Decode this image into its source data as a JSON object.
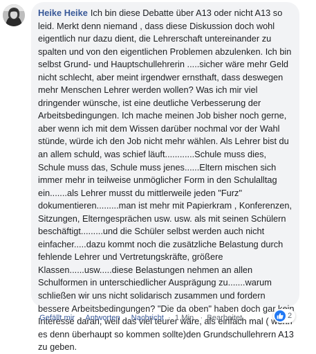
{
  "comment": {
    "author": "Heike Heike",
    "text": "Ich bin diese Debatte über A13 oder nicht A13 so leid. Merkt denn niemand , dass diese Diskussion doch wohl eigentlich nur dazu dient, die Lehrerschaft untereinander zu spalten und von den eigentlichen Problemen abzulenken. Ich bin selbst Grund- und Hauptschullehrerin .....sicher wäre mehr Geld nicht schlecht, aber meint irgendwer ernsthaft, dass deswegen mehr Menschen Lehrer werden wollen? Was ich mir viel dringender wünsche, ist eine deutliche Verbesserung der Arbeitsbedingungen. Ich mache meinen Job bisher noch gerne, aber wenn ich mit dem Wissen darüber nochmal vor der Wahl stünde, würde ich den Job nicht mehr wählen. Als Lehrer bist du an allem schuld, was schief läuft............Schule muss dies, Schule muss das, Schule muss jenes......Eltern mischen sich immer mehr in teilweise unmöglicher Form in den Schulalltag ein.......als Lehrer musst du mittlerweile jeden \"Furz\" dokumentieren.........man ist mehr mit Papierkram , Konferenzen, Sitzungen, Elterngesprächen usw. usw. als mit seinen Schülern beschäftigt.........und die Schüler selbst werden auch nicht einfacher.....dazu kommt noch die zusätzliche Belastung durch fehlende Lehrer und Vertretungskräfte, größere Klassen......usw.....diese Belastungen nehmen an allen Schulformen in unterschiedlicher Ausprägung zu.......warum schließen wir uns nicht solidarisch zusammen und fordern bessere Arbeitsbedingungen? \"Die da oben\" haben doch gar kein Interesse daran, weil das viel teurer wäre, als einfach mal ( wenn es denn überhaupt so kommen sollte)den Grundschullehrern A13 zu geben."
  },
  "reactions": {
    "icon": "thumbs-up-icon",
    "count": "2",
    "color": "#2078f4"
  },
  "actions": {
    "like": "Gefällt mir",
    "reply": "Antworten",
    "message": "Nachricht",
    "time": "1 Min.",
    "edited": "Bearbeitet",
    "separator": "·"
  },
  "colors": {
    "bubble": "#f2f3f5",
    "author_link": "#385898",
    "meta_text": "#606770"
  }
}
